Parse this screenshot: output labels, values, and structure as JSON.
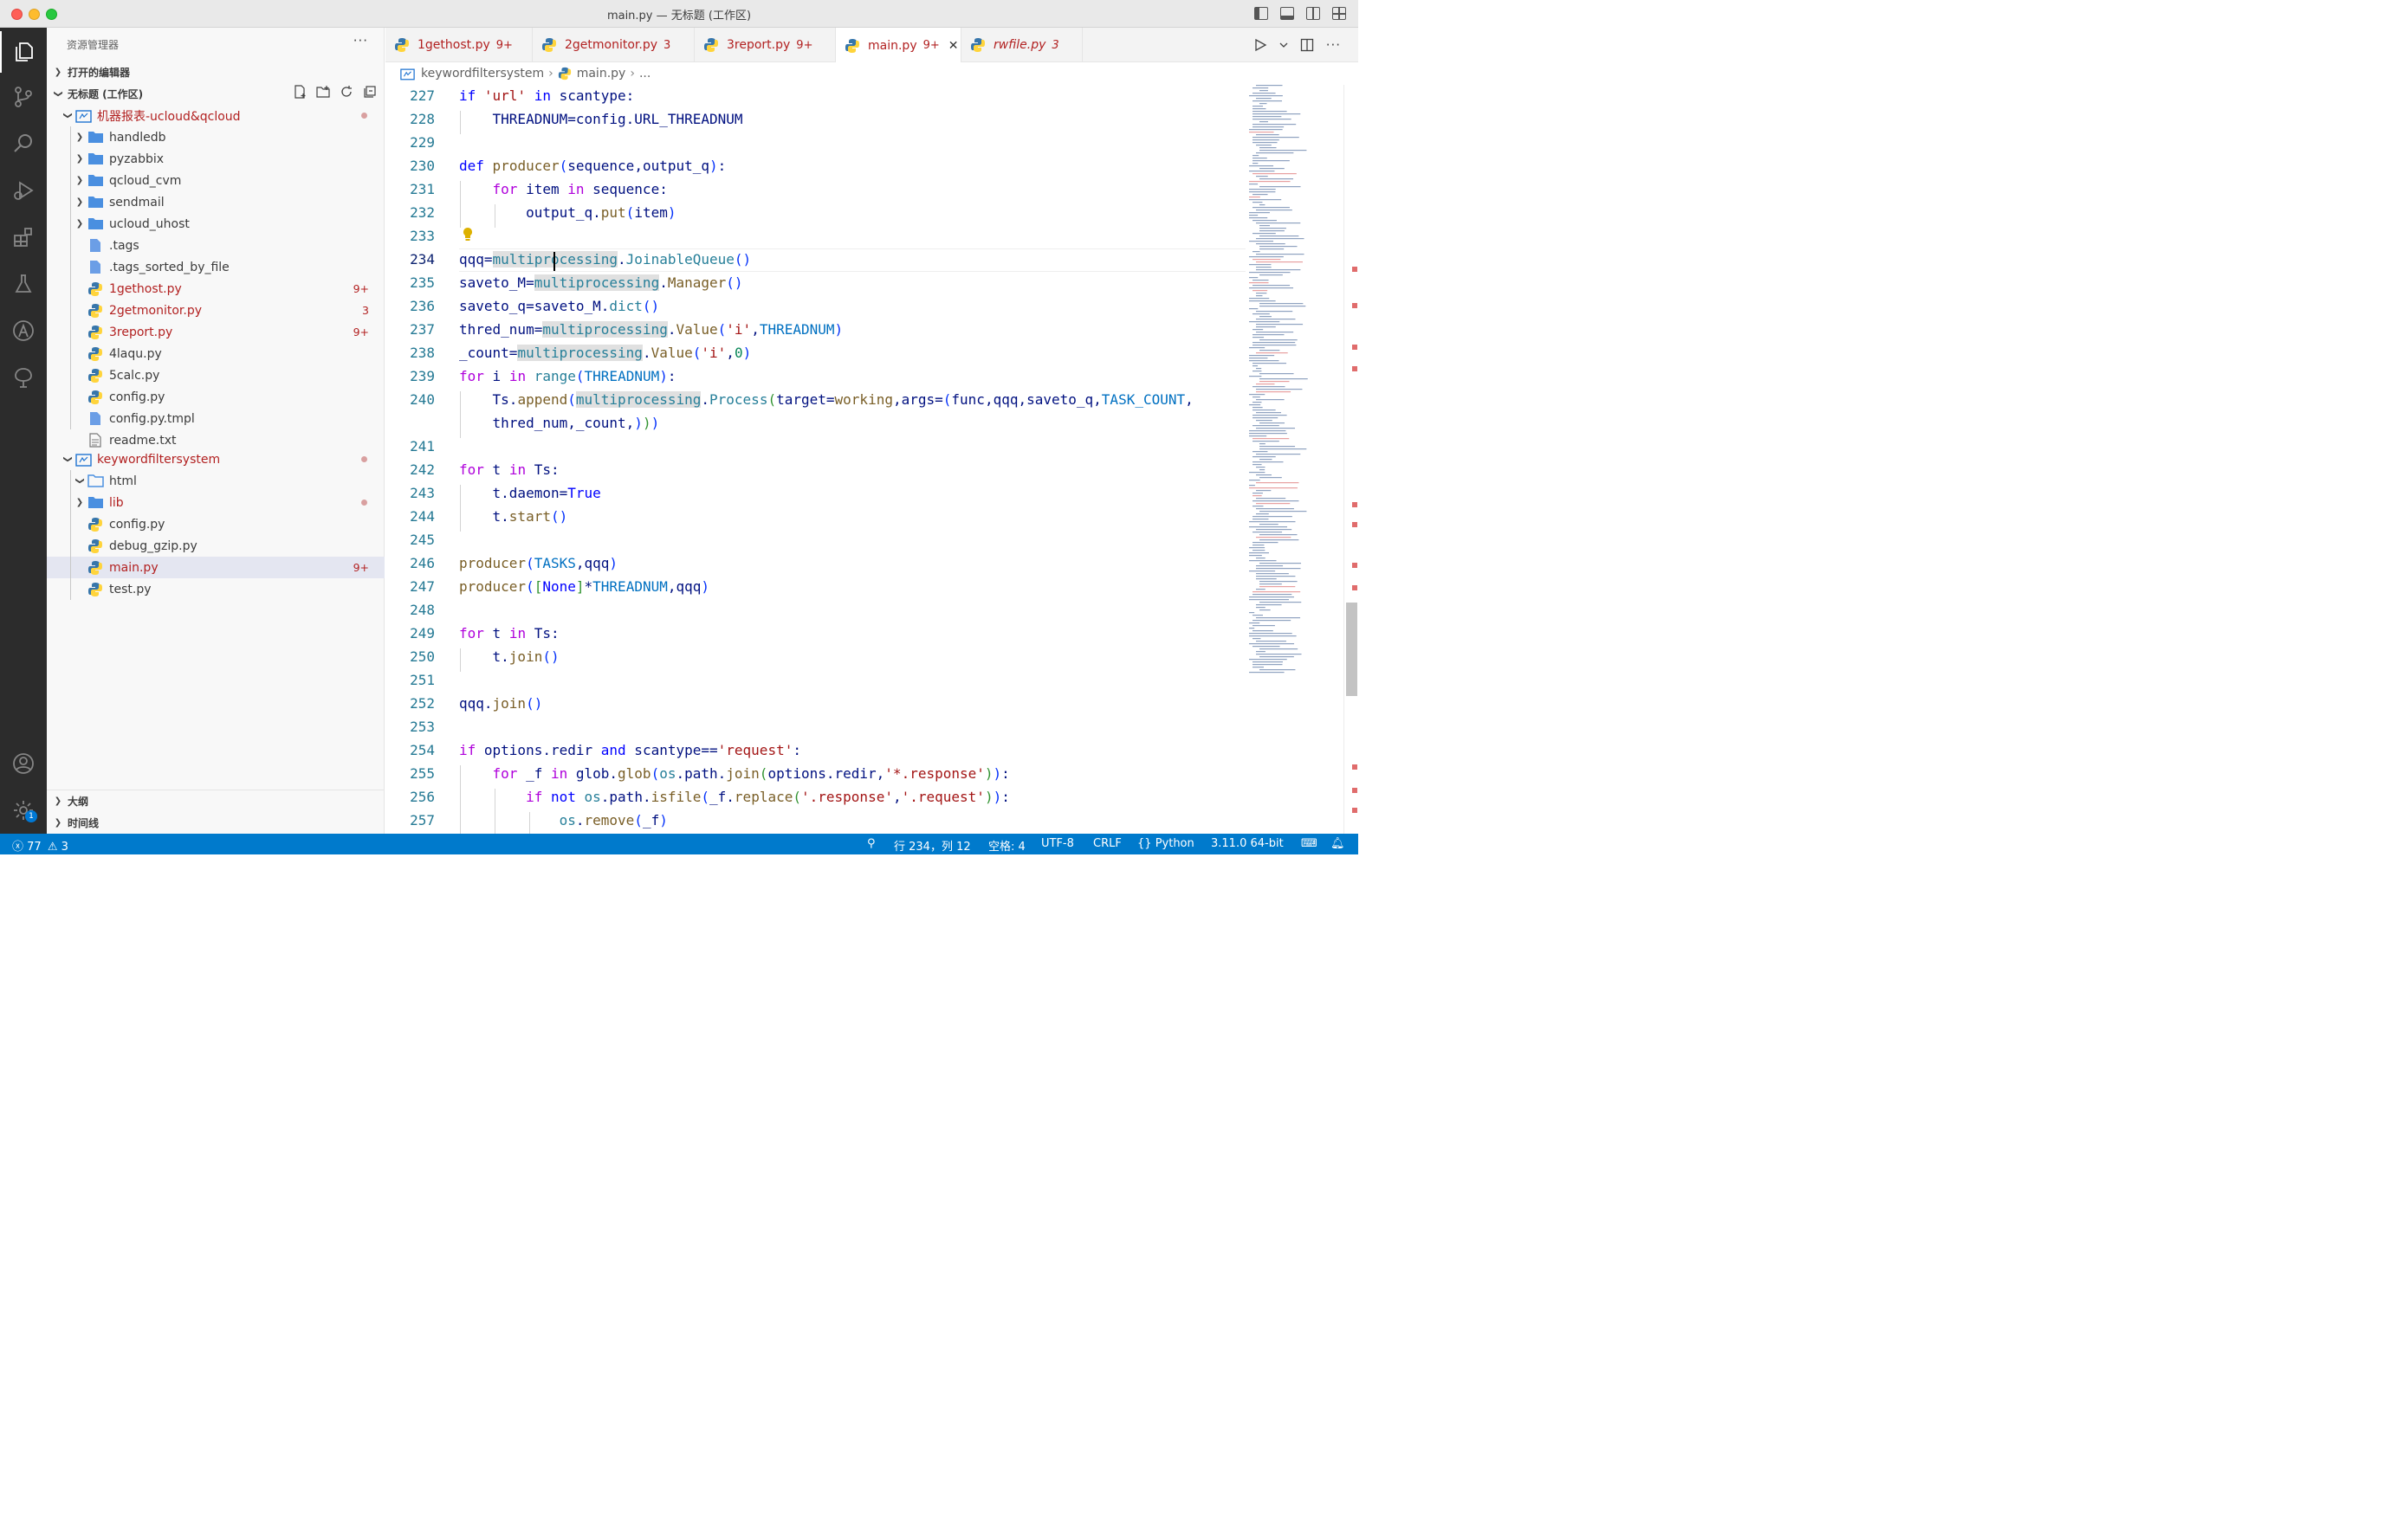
{
  "window": {
    "title": "main.py — 无标题 (工作区)"
  },
  "sidebar": {
    "title": "资源管理器",
    "open_editors": "打开的编辑器",
    "workspace": "无标题 (工作区)",
    "outline": "大纲",
    "timeline": "时间线",
    "tree": [
      {
        "label": "机器报表-ucloud&qcloud",
        "badge": ""
      },
      {
        "label": "handledb",
        "badge": ""
      },
      {
        "label": "pyzabbix",
        "badge": ""
      },
      {
        "label": "qcloud_cvm",
        "badge": ""
      },
      {
        "label": "sendmail",
        "badge": ""
      },
      {
        "label": "ucloud_uhost",
        "badge": ""
      },
      {
        "label": ".tags",
        "badge": ""
      },
      {
        "label": ".tags_sorted_by_file",
        "badge": ""
      },
      {
        "label": "1gethost.py",
        "badge": "9+"
      },
      {
        "label": "2getmonitor.py",
        "badge": "3"
      },
      {
        "label": "3report.py",
        "badge": "9+"
      },
      {
        "label": "4laqu.py",
        "badge": ""
      },
      {
        "label": "5calc.py",
        "badge": ""
      },
      {
        "label": "config.py",
        "badge": ""
      },
      {
        "label": "config.py.tmpl",
        "badge": ""
      },
      {
        "label": "readme.txt",
        "badge": ""
      },
      {
        "label": "keywordfiltersystem",
        "badge": ""
      },
      {
        "label": "html",
        "badge": ""
      },
      {
        "label": "lib",
        "badge": ""
      },
      {
        "label": "config.py",
        "badge": ""
      },
      {
        "label": "debug_gzip.py",
        "badge": ""
      },
      {
        "label": "main.py",
        "badge": "9+"
      },
      {
        "label": "test.py",
        "badge": ""
      }
    ]
  },
  "tabs": [
    {
      "label": "1gethost.py",
      "count": "9+"
    },
    {
      "label": "2getmonitor.py",
      "count": "3"
    },
    {
      "label": "3report.py",
      "count": "9+"
    },
    {
      "label": "main.py",
      "count": "9+",
      "close": "✕"
    },
    {
      "label": "rwfile.py",
      "count": "3"
    }
  ],
  "breadcrumb": {
    "folder": "keywordfiltersystem",
    "file": "main.py",
    "tail": "..."
  },
  "editor": {
    "line_numbers": [
      "227",
      "228",
      "229",
      "230",
      "231",
      "232",
      "233",
      "234",
      "235",
      "236",
      "237",
      "238",
      "239",
      "240",
      "241",
      "242",
      "243",
      "244",
      "245",
      "246",
      "247",
      "248",
      "249",
      "250",
      "251",
      "252",
      "253",
      "254",
      "255",
      "256",
      "257"
    ]
  },
  "status": {
    "errors": "77",
    "warnings": "3",
    "position": "行 234，列 12",
    "spaces": "空格: 4",
    "encoding": "UTF-8",
    "eol": "CRLF",
    "language": "Python",
    "interpreter": "3.11.0 64-bit",
    "gear_badge": "1"
  },
  "colors": {
    "statusbar": "#007acc",
    "error_text": "#b22121",
    "activity_bar": "#2c2c2c",
    "keyword": "#0000ff",
    "control": "#af00db"
  }
}
